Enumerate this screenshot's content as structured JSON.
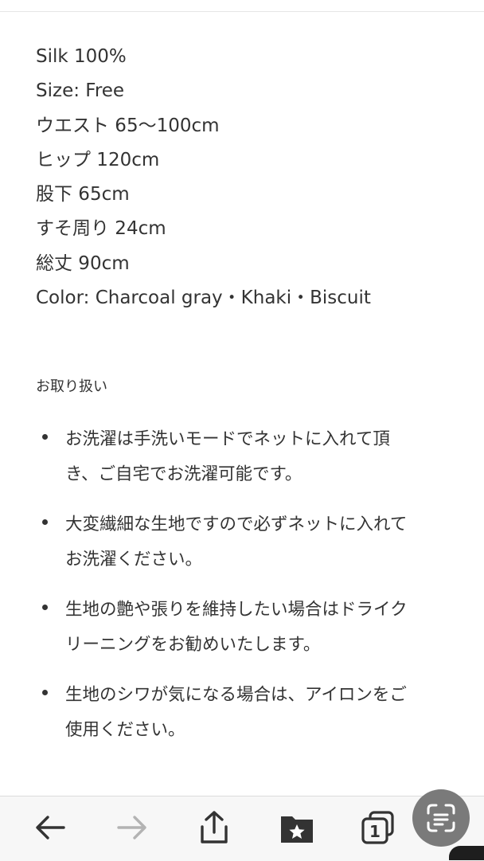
{
  "specs": [
    "Silk 100%",
    "Size: Free",
    "ウエスト 65〜100cm",
    "ヒップ 120cm",
    "股下 65cm",
    "すそ周り 24cm",
    "総丈 90cm",
    "Color: Charcoal gray・Khaki・Biscuit"
  ],
  "care": {
    "heading": "お取り扱い",
    "items": [
      {
        "line1": "お洗濯は手洗いモードでネットに入れて頂",
        "line2": "き、ご自宅でお洗濯可能です。"
      },
      {
        "line1": "大変繊細な生地ですので必ずネットに入れて",
        "line2": "お洗濯ください。"
      },
      {
        "line1": "生地の艶や張りを維持したい場合はドライク",
        "line2": "リーニングをお勧めいたします。"
      },
      {
        "line1": "生地のシワが気になる場合は、アイロンをご",
        "line2": "使用ください。"
      }
    ]
  },
  "toolbar": {
    "back_icon": "arrow-left-icon",
    "forward_icon": "arrow-right-icon",
    "share_icon": "share-icon",
    "bookmarks_icon": "bookmark-folder-star-icon",
    "tabs_icon": "tabs-icon",
    "tab_count": "1",
    "lens_icon": "scan-text-icon",
    "colors": {
      "active": "#333333",
      "disabled": "#b3b3b3",
      "lens_bg": "#7a7a7a"
    }
  }
}
